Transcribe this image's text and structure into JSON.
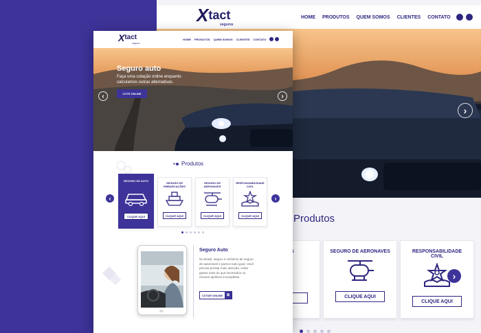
{
  "brand": {
    "name": "tact",
    "tagline": "seguros"
  },
  "nav": {
    "items": [
      "HOME",
      "PRODUTOS",
      "QUEM SOMOS",
      "CLIENTES",
      "CONTATO"
    ],
    "social": [
      "f",
      "ig"
    ]
  },
  "hero": {
    "title": "Seguro auto",
    "description": "Faça uma cotação online enquanto calculamos outras alternativas.",
    "button": "COTE ONLINE",
    "prev": "‹",
    "next": "›"
  },
  "products": {
    "heading": "Produtos",
    "cards": [
      {
        "title": "SEGURO DE AUTO",
        "icon": "car-icon",
        "button": "CLIQUE AQUI",
        "active": true
      },
      {
        "title": "SEGURO DE EMBARCAÇÕES",
        "icon": "ship-icon",
        "button": "CLIQUE AQUI",
        "active": false
      },
      {
        "title": "SEGURO DE AERONAVES",
        "icon": "helicopter-icon",
        "button": "CLIQUE AQUI",
        "active": false
      },
      {
        "title": "RESPONSABILIDADE CIVIL",
        "icon": "hand-star-icon",
        "button": "CLIQUE AQUI",
        "active": false
      }
    ],
    "back_cards": [
      {
        "title": "DE ÇÕES",
        "button": "AQUI"
      },
      {
        "title": "SEGURO DE AERONAVES",
        "button": "CLIQUE AQUI"
      },
      {
        "title": "RESPONSABILIDADE CIVIL",
        "button": "CLIQUE AQUI"
      }
    ],
    "pager_count": 6,
    "pager_active": 0
  },
  "info": {
    "title": "Seguro Auto",
    "text": "No Brasil, seguro é sinônimo de seguro de automóvel e parece tudo igual. Você precisa prestar mais atenção, evitar gastar mais do que necessário ou renovar apólices incompletas.",
    "button": "COTAR ONLINE",
    "button_icon": "external-link-icon"
  },
  "colors": {
    "brand": "#3d3399",
    "dark": "#2d2680"
  }
}
